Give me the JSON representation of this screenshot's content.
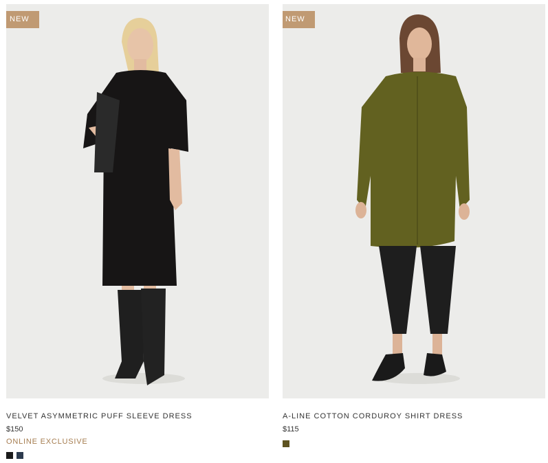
{
  "colors": {
    "badge_bg": "#c09a73",
    "exclusive_text": "#a57c4f"
  },
  "products": [
    {
      "badge": "NEW",
      "name": "VELVET ASYMMETRIC PUFF SLEEVE DRESS",
      "price": "$150",
      "note": "ONLINE EXCLUSIVE",
      "swatches": [
        "#1b1b1b",
        "#2c3a4d"
      ]
    },
    {
      "badge": "NEW",
      "name": "A-LINE COTTON CORDUROY SHIRT DRESS",
      "price": "$115",
      "swatches": [
        "#5e5320"
      ]
    }
  ]
}
